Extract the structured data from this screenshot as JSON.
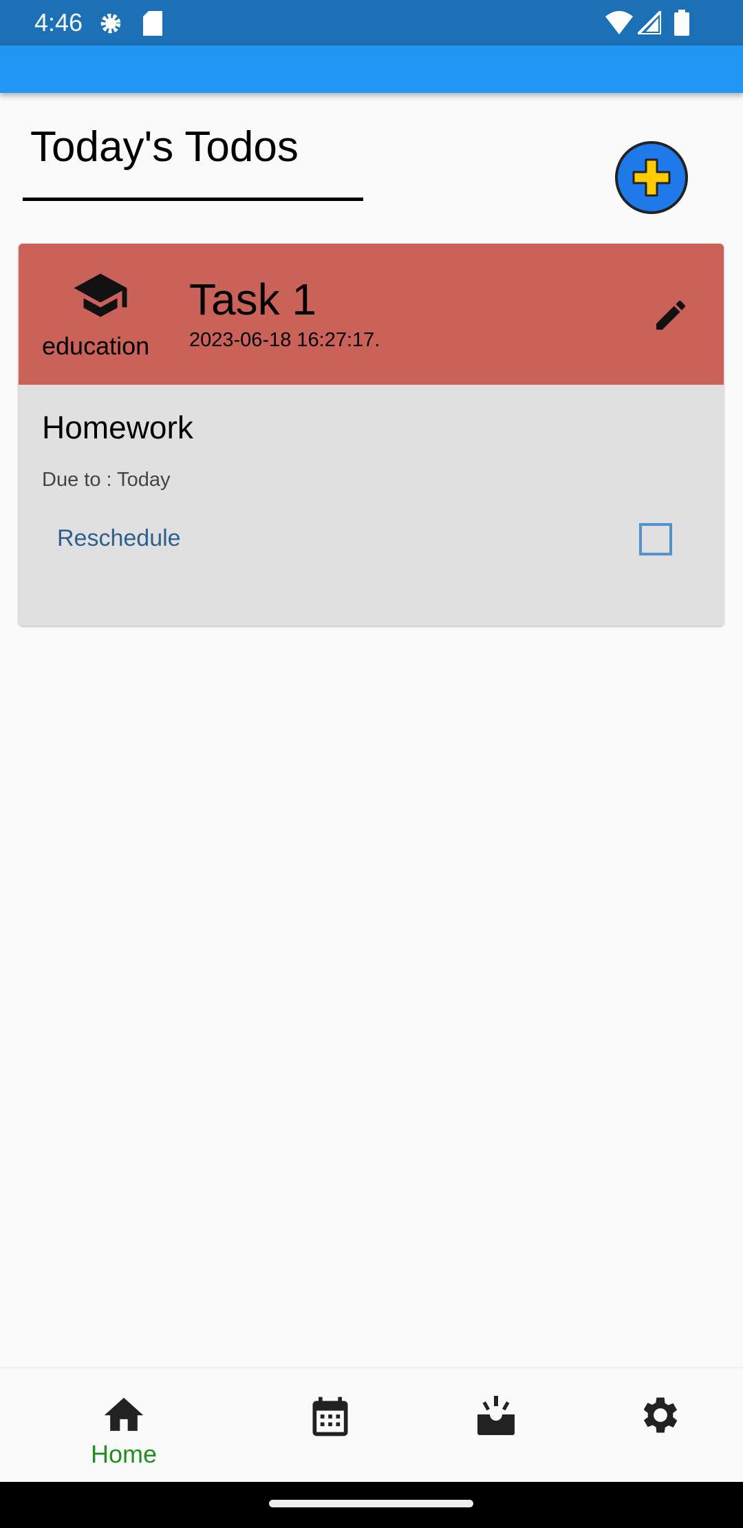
{
  "status_bar": {
    "time": "4:46",
    "icons": [
      "gear-icon",
      "sd-card-icon",
      "wifi-icon",
      "signal-icon",
      "battery-icon"
    ]
  },
  "header": {
    "title": "Today's Todos",
    "add_icon": "add-circle-icon"
  },
  "todos": [
    {
      "category": "education",
      "category_icon": "graduation-cap-icon",
      "title": "Task 1",
      "created": "2023-06-18 16:27:17.",
      "description": "Homework",
      "due": "Due to :  Today",
      "reschedule_label": "Reschedule",
      "completed": false,
      "header_color": "#cb625a"
    }
  ],
  "bottom_nav": {
    "items": [
      {
        "label": "Home",
        "icon": "home-icon",
        "active": true
      },
      {
        "icon": "calendar-icon"
      },
      {
        "icon": "alarm-icon"
      },
      {
        "icon": "settings-icon"
      }
    ],
    "active_color": "#1f8f1f"
  }
}
